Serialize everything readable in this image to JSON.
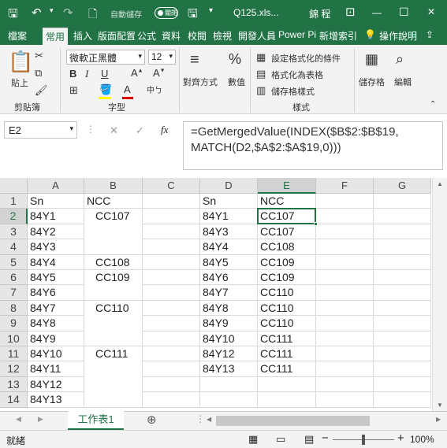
{
  "titlebar": {
    "autosave_label": "自動儲存",
    "autosave_state": "關閉",
    "filename": "Q125.xls...",
    "user": "錦 程",
    "minimize": "—",
    "restore": "☐",
    "close": "✕"
  },
  "tabs": [
    "檔案",
    "常用",
    "插入",
    "版面配置",
    "公式",
    "資料",
    "校閱",
    "檢視",
    "開發人員",
    "Power Pi",
    "新增索引"
  ],
  "tell_me": "操作說明",
  "ribbon": {
    "paste": "貼上",
    "clipboard_group": "剪貼簿",
    "font_name": "微軟正黑體",
    "font_size": "12",
    "font_group": "字型",
    "align_label": "對齊方式",
    "number_label": "數值",
    "cond_format": "設定格式化的條件",
    "format_table": "格式化為表格",
    "cell_styles": "儲存格樣式",
    "styles_group": "樣式",
    "cells_label": "儲存格",
    "editing_label": "編輯"
  },
  "formula_bar": {
    "name_box": "E2",
    "formula": "=GetMergedValue(INDEX($B$2:$B$19,\nMATCH(D2,$A$2:$A$19,0)))"
  },
  "columns": [
    "A",
    "B",
    "C",
    "D",
    "E",
    "F",
    "G"
  ],
  "rows": [
    "1",
    "2",
    "3",
    "4",
    "5",
    "6",
    "7",
    "8",
    "9",
    "10",
    "11",
    "12",
    "13",
    "14"
  ],
  "cells": {
    "A": [
      "Sn",
      "84Y1",
      "84Y2",
      "84Y3",
      "84Y4",
      "84Y5",
      "84Y6",
      "84Y7",
      "84Y8",
      "84Y9",
      "84Y10",
      "84Y11",
      "84Y12",
      "84Y13"
    ],
    "B": [
      "NCC",
      "CC107",
      "",
      "",
      "CC108",
      "CC109",
      "",
      "CC110",
      "",
      "",
      "CC111",
      "",
      "",
      ""
    ],
    "D": [
      "Sn",
      "84Y1",
      "84Y3",
      "84Y4",
      "84Y5",
      "84Y6",
      "84Y7",
      "84Y8",
      "84Y9",
      "84Y10",
      "84Y12",
      "84Y13",
      "",
      ""
    ],
    "E": [
      "NCC",
      "CC107",
      "CC107",
      "CC108",
      "CC109",
      "CC109",
      "CC110",
      "CC110",
      "CC110",
      "CC111",
      "CC111",
      "CC111",
      "",
      ""
    ]
  },
  "sheet_tab": "工作表1",
  "status": {
    "ready": "就緒",
    "zoom": "100%"
  },
  "colors": {
    "excel_green": "#217346"
  }
}
